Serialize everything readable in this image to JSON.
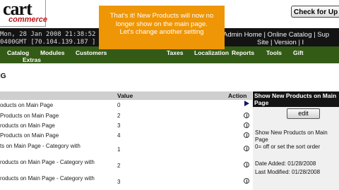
{
  "header": {
    "logo_text": "cart",
    "logo_sub": "commerce",
    "check_button": "Check for Up"
  },
  "status": {
    "datetime": "Mon, 28 Jan 2008 21:38:52 -",
    "ip": "0400GMT [70.104.139.187 ]",
    "admin_links": "Admin Home | Online Catalog | Sup",
    "site_links": "Site | Version | I"
  },
  "menu": {
    "row1": [
      "Catalog",
      "Modules",
      "Customers",
      "Taxes",
      "Localization",
      "Reports",
      "Tools",
      "Gift"
    ],
    "row2": [
      "Extras"
    ]
  },
  "callout": {
    "lines": [
      "That's it!  New Products will now no",
      "longer show on the main page.",
      "Let's change another setting"
    ]
  },
  "page_title": "IG",
  "table": {
    "headers": {
      "title": "",
      "value": "Value",
      "action": "Action"
    },
    "rows": [
      {
        "title": "oducts on Main Page",
        "value": "0"
      },
      {
        "title": "Products on Main Page",
        "value": "2"
      },
      {
        "title": "roducts on Main Page",
        "value": "3"
      },
      {
        "title": " Products on Main Page",
        "value": "4"
      },
      {
        "title": "ts on Main Page - Category with",
        "value": "1"
      },
      {
        "title": "roducts on Main Page - Category with",
        "value": "2"
      },
      {
        "title": "roducts on Main Page - Category with",
        "value": "3"
      }
    ]
  },
  "panel": {
    "title": "Show New Products on Main Page",
    "edit_button": "edit",
    "description": [
      "Show New Products on Main",
      "Page",
      "0= off or set the sort order"
    ],
    "date_added": "Date Added: 01/28/2008",
    "last_modified": "Last Modified: 01/28/2008"
  }
}
